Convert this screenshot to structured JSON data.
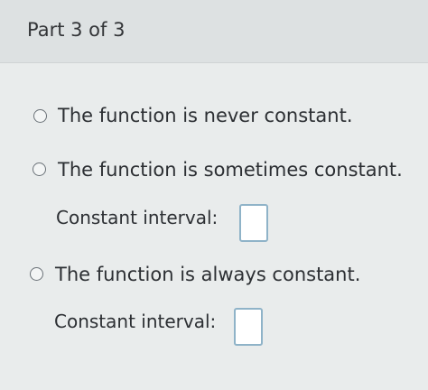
{
  "header": {
    "part_label": "Part 3 of 3"
  },
  "options": [
    {
      "label": "The function is never constant.",
      "selected": false
    },
    {
      "label": "The function is sometimes constant.",
      "selected": false,
      "interval_label": "Constant interval:",
      "interval_value": ""
    },
    {
      "label": "The function is always constant.",
      "selected": false,
      "interval_label": "Constant interval:",
      "interval_value": ""
    }
  ]
}
